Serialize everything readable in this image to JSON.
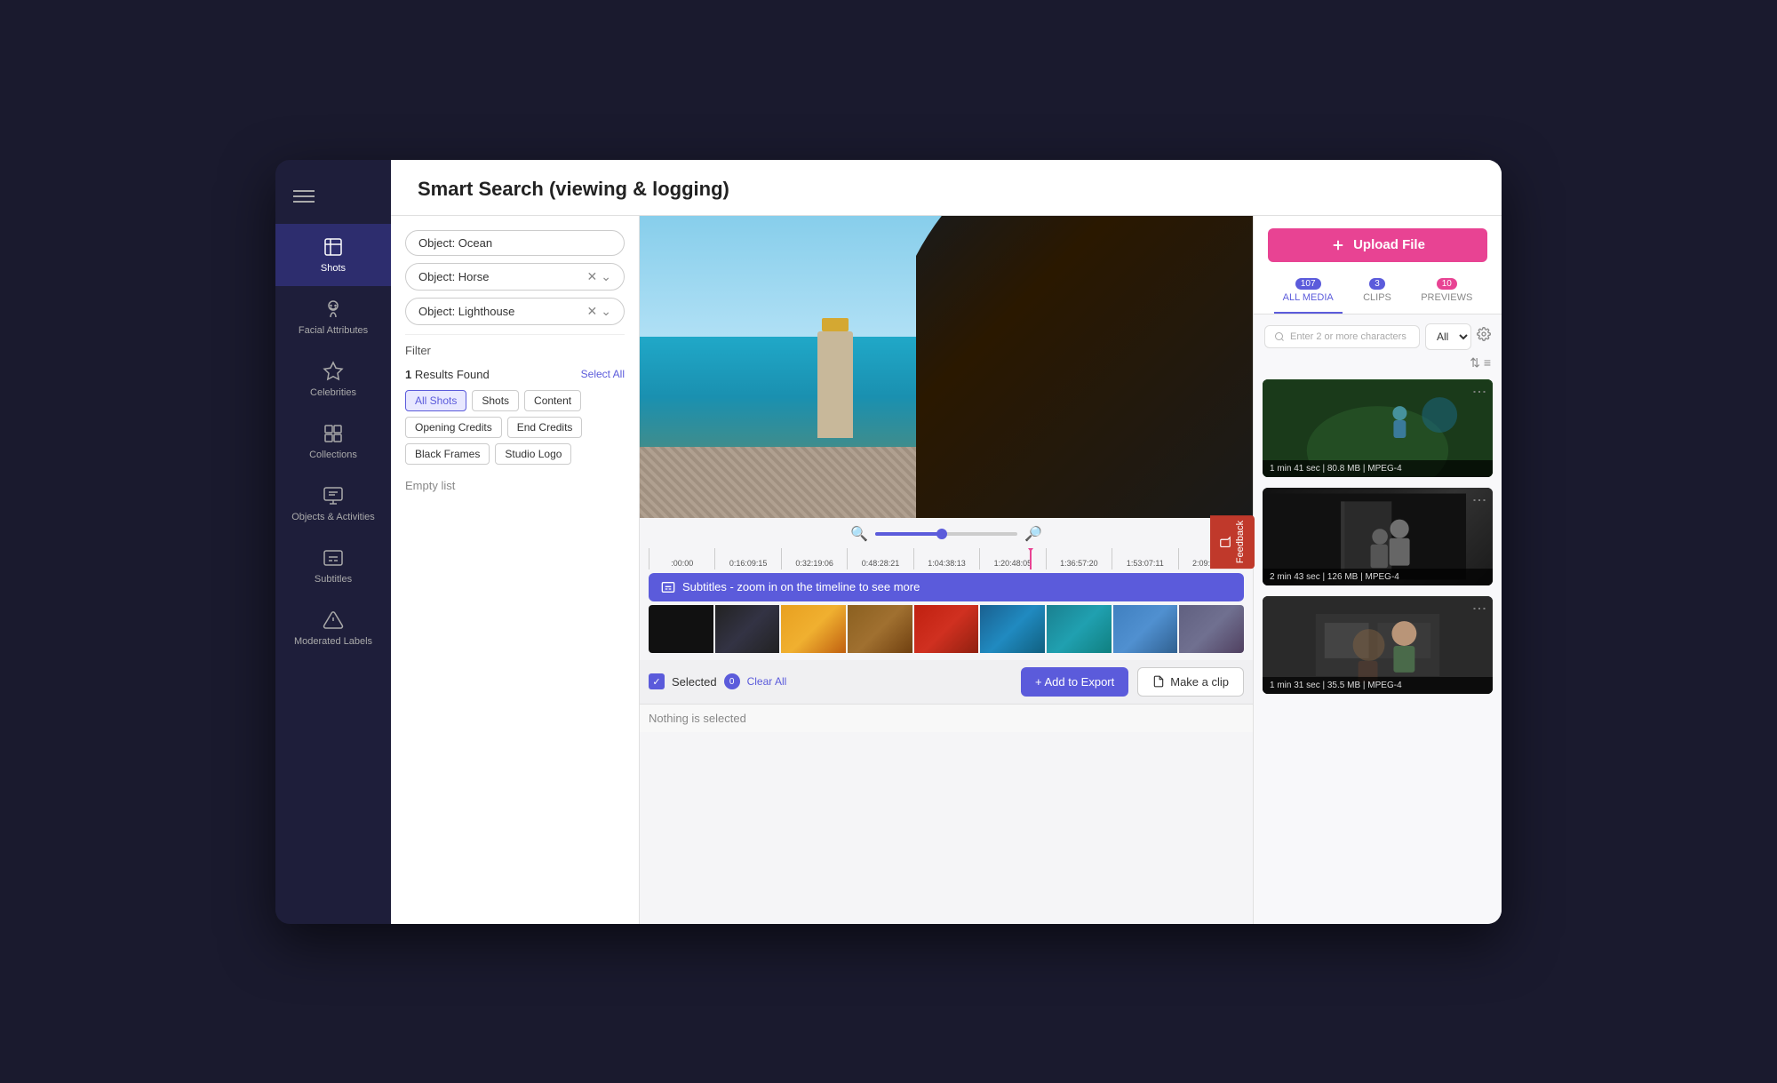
{
  "app": {
    "title": "Smart Search (viewing & logging)"
  },
  "sidebar": {
    "hamburger_label": "Menu",
    "items": [
      {
        "id": "shots",
        "label": "Shots",
        "active": true
      },
      {
        "id": "facial-attributes",
        "label": "Facial Attributes",
        "active": false
      },
      {
        "id": "celebrities",
        "label": "Celebrities",
        "active": false
      },
      {
        "id": "collections",
        "label": "Collections",
        "active": false
      },
      {
        "id": "objects-activities",
        "label": "Objects & Activities",
        "active": false
      },
      {
        "id": "subtitles",
        "label": "Subtitles",
        "active": false
      },
      {
        "id": "moderated-labels",
        "label": "Moderated Labels",
        "active": false
      }
    ]
  },
  "search_tags": [
    {
      "id": "tag-ocean",
      "value": "Object: Ocean",
      "removable": false
    },
    {
      "id": "tag-horse",
      "value": "Object: Horse",
      "removable": true
    },
    {
      "id": "tag-lighthouse",
      "value": "Object: Lighthouse",
      "removable": true
    }
  ],
  "filter": {
    "label": "Filter"
  },
  "results": {
    "count": "1",
    "label": "Results Found",
    "select_all": "Select All"
  },
  "filter_tags": [
    {
      "id": "all-shots",
      "label": "All Shots",
      "active": true
    },
    {
      "id": "shots",
      "label": "Shots",
      "active": false
    },
    {
      "id": "content",
      "label": "Content",
      "active": false
    },
    {
      "id": "opening-credits",
      "label": "Opening Credits",
      "active": false
    },
    {
      "id": "end-credits",
      "label": "End Credits",
      "active": false
    },
    {
      "id": "black-frames",
      "label": "Black Frames",
      "active": false
    },
    {
      "id": "studio-logo",
      "label": "Studio Logo",
      "active": false
    }
  ],
  "empty_list": "Empty list",
  "timeline": {
    "markers": [
      ":00:00",
      "0:16:09:15",
      "0:32:19:06",
      "0:48:28:21",
      "1:04:38:13",
      "1:20:48:05",
      "1:36:57:20",
      "1:53:07:11",
      "2:09:17:03"
    ],
    "zoom_percent": 45
  },
  "subtitles_bar": {
    "text": "Subtitles - zoom in on the timeline to see more"
  },
  "bottom_controls": {
    "selected_label": "Selected",
    "selected_count": "0",
    "clear_all": "Clear All",
    "add_to_export": "+ Add to Export",
    "make_clip": "Make a clip",
    "nothing_selected": "Nothing is selected"
  },
  "right_panel": {
    "upload_button": "Upload File",
    "tabs": [
      {
        "id": "all-media",
        "label": "ALL MEDIA",
        "badge": "107",
        "badge_color": "purple",
        "active": true
      },
      {
        "id": "clips",
        "label": "CLIPS",
        "badge": "3",
        "badge_color": "purple",
        "active": false
      },
      {
        "id": "previews",
        "label": "PREVIEWS",
        "badge": "10",
        "badge_color": "pink",
        "active": false
      }
    ],
    "search_placeholder": "Enter 2 or more characters",
    "filter_option": "All",
    "media_cards": [
      {
        "id": "card-1",
        "duration": "1 min 41 sec",
        "size": "80.8 MB",
        "format": "MPEG-4",
        "thumb_style": "1"
      },
      {
        "id": "card-2",
        "duration": "2 min 43 sec",
        "size": "126 MB",
        "format": "MPEG-4",
        "thumb_style": "2"
      },
      {
        "id": "card-3",
        "duration": "1 min 31 sec",
        "size": "35.5 MB",
        "format": "MPEG-4",
        "thumb_style": "3"
      }
    ]
  },
  "feedback": {
    "label": "Feedback"
  }
}
